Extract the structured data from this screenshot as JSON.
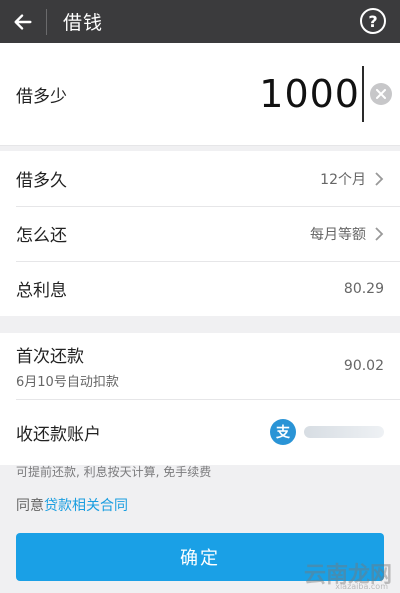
{
  "header": {
    "title": "借钱",
    "help_glyph": "?"
  },
  "amount": {
    "label": "借多少",
    "value": "1000"
  },
  "rows": [
    {
      "label": "借多久",
      "value": "12个月"
    },
    {
      "label": "怎么还",
      "value": "每月等额"
    },
    {
      "label": "总利息",
      "value": "80.29"
    }
  ],
  "first_payment": {
    "label": "首次还款",
    "sub": "6月10号自动扣款",
    "value": "90.02"
  },
  "account": {
    "label": "收还款账户",
    "icon_text": "支"
  },
  "note": "可提前还款, 利息按天计算, 免手续费",
  "agree": {
    "prefix": "同意",
    "link": "贷款相关合同"
  },
  "confirm_label": "确定",
  "watermark": {
    "main": "云南龙网",
    "sub": "xiazaiba.com"
  },
  "colors": {
    "titlebar": "#3b3b3d",
    "accent": "#1aa0e6",
    "alipay": "#2a94d6"
  }
}
